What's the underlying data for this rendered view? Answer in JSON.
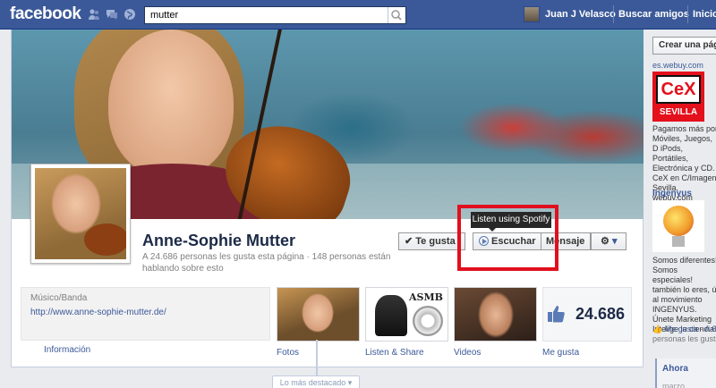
{
  "topbar": {
    "logo": "facebook",
    "search_value": "mutter",
    "user_name": "Juan J Velasco",
    "find_friends": "Buscar amigos",
    "home": "Inicio"
  },
  "page": {
    "name": "Anne-Sophie Mutter",
    "stats": "A 24.686 personas les gusta esta página · 148 personas están hablando sobre esto",
    "category": "Músico/Banda",
    "url": "http://www.anne-sophie-mutter.de/",
    "info_label": "Información"
  },
  "actions": {
    "like": "Te gusta",
    "listen": "Escuchar",
    "message": "Mensaje",
    "tooltip": "Listen using Spotify"
  },
  "tiles": [
    {
      "label": "Fotos"
    },
    {
      "label": "Listen & Share"
    },
    {
      "label": "Videos"
    },
    {
      "label": "Me gusta"
    }
  ],
  "tile_text": "ASMB",
  "likes_count": "24.686",
  "timeline": {
    "pill": "Lo más destacado ▾"
  },
  "sidebar": {
    "create_button": "Crear una pág",
    "ad1_source": "es.webuy.com",
    "ad1_logo": "CeX",
    "ad1_city": "SEVILLA",
    "ad1_text": "Pagamos más por Móviles, Juegos, D iPods, Portátiles, Electrónica y CD. CeX en C/Imagen Sevilla. webuy.com",
    "ad2_title": "Ingenyus",
    "ad2_text": "Somos diferentes! Somos especiales! también lo eres, ú al movimiento INGENYUS. Únete Marketing Intelige la ciencia!",
    "ad2_like": "Me gusta · A 6",
    "ad2_like2": "personas les gusta",
    "ahora": "Ahora",
    "marzo": "marzo"
  },
  "colors": {
    "facebook_blue": "#3b5998",
    "highlight_red": "#e0101e",
    "cex_red": "#e4101b"
  }
}
